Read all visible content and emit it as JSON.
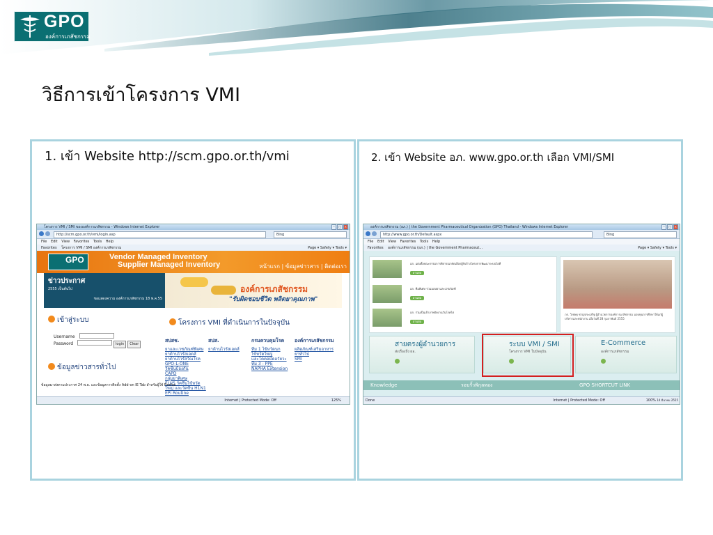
{
  "logo": {
    "name": "GPO",
    "subtitle": "องค์การเภสัชกรรม"
  },
  "slide": {
    "title": "วิธีการเข้าโครงการ VMI"
  },
  "left_panel": {
    "caption": "1. เข้า Website http://scm.gpo.or.th/vmi",
    "browser": {
      "title": "โครงการ VMI / SMI ขององค์การเภสัชกรรม - Windows Internet Explorer",
      "url": "http://scm.gpo.or.th/vmi/login.asp",
      "search": "Bing",
      "menu": "File  Edit  View  Favorites  Tools  Help",
      "favorites": "Favorites",
      "tab": "โครงการ VMI / SMI องค์การเภสัชกรรม",
      "toolbar": "Page ▾  Safety ▾  Tools ▾",
      "status_zone": "Internet | Protected Mode: Off",
      "zoom": "125%"
    },
    "page": {
      "header_line1": "Vendor Managed Inventory",
      "header_line2": "Supplier Managed Inventory",
      "mini_logo": "GPO",
      "header_links": "หน้าแรก | ข้อมูลข่าวสาร | ติดต่อเรา",
      "news_title": "ข่าวประกาศ",
      "news_sub": "2555 เป็นต้นไป",
      "news_sub2": "ขอแสดงความ องค์การเภสัชกรรม 18 พ.ค.55",
      "banner_title": "องค์การเภสัชกรรม",
      "banner_slogan": "\"รับผิดชอบชีวิต พลิตยาคุณภาพ\"",
      "login_title": "เข้าสู่ระบบ",
      "username_label": "Username",
      "password_label": "Password",
      "login_btn": "login",
      "clear_btn": "Clear",
      "projects_title": "โครงการ VMI ที่ดำเนินการในปัจจุบัน",
      "info_title": "ข้อมูลข่าวสารทั่วไป",
      "columns": [
        {
          "head": "สปสช.",
          "items": [
            "ยาและเวชภัณฑ์พิเศษ",
            "ยาต้านไวรัสเอดส์",
            "ยาต้านไวรัสวัณโรค",
            "GPO-L-ONE",
            "วัคซีนป้องกัน",
            "CAPD",
            "กลุ่มยาพิเศษ",
            "FLUS วัคซีนไข้หวัด",
            "ใหญ่ และวัคซีน H1N1",
            "EPI Routine"
          ]
        },
        {
          "head": "สปส.",
          "items": [
            "ยาต้านไวรัสเอดส์"
          ]
        },
        {
          "head": "กรมควบคุมโรค",
          "items": [
            "ทีม 1 ไข้หวัดนก",
            "ไข้หวัดใหญ่",
            "และโคคอมัดอวัยวะ",
            "ทีม 3 - PPE",
            "NAPHA Extension"
          ]
        },
        {
          "head": "องค์การเภสัชกรรม",
          "items": [
            "ผลิตภัณฑ์เสริมอาหาร",
            "ยาทั่วไป",
            "SMI"
          ]
        }
      ],
      "news_line": "ข้อมูลมาส่งตามประกาศ 24 พ.ย. และข้อมูลการติดตั้ง Add-on IE Tab สำหรับผู้ใช้ Firefox"
    }
  },
  "right_panel": {
    "caption": "2. เข้า Website อภ. www.gpo.or.th เลือก VMI/SMI",
    "browser": {
      "title": "องค์การเภสัชกรรม (อภ.) | the Government Pharmaceutical Organization (GPO) Thailand - Windows Internet Explorer",
      "url": "http://www.gpo.or.th/Default.aspx",
      "search": "Bing",
      "menu": "File  Edit  View  Favorites  Tools  Help",
      "favorites": "Favorites",
      "tab": "องค์การเภสัชกรรม (อภ.) | the Government Pharmaceut...",
      "toolbar": "Page ▾  Safety ▾  Tools ▾",
      "status_left": "Done",
      "status_zone": "Internet | Protected Mode: Off",
      "zoom": "100%"
    },
    "page": {
      "news": [
        {
          "text": "อภ. แต่งตั้งคณะกรรมการพิจารณาคัดเลือกผู้รับจ้างโครงการพัฒนาระบบไอที",
          "btn": "อ่านต่อ"
        },
        {
          "text": "อภ. ทีมพิเศษ ร่วมมอบยาและเวชภัณฑ์",
          "btn": "อ่านต่อ"
        },
        {
          "text": "อภ. ร่วมเป็นเจ้าภาพจัดงานวันโรคไต",
          "btn": "อ่านต่อ"
        }
      ],
      "photo_caption": "ภก. วิเชษฐ ชาญประเสริฐ ผู้อำนวยการองค์การเภสัชกรรม มอบทุนการศึกษาให้แก่ผู้บริหารและพนักงาน เมื่อวันที่ 28 กุมภาพันธ์ 2555",
      "tiles": [
        {
          "title": "สายตรงผู้อำนวยการ",
          "sub": "ส่งเรื่องถึง ผอ."
        },
        {
          "title": "ระบบ VMI / SMI",
          "sub": "โครงการ VMI ในปัจจุบัน"
        },
        {
          "title": "E-Commerce",
          "sub": "องค์การเภสัชกรรม"
        }
      ],
      "footer": [
        "Knowledge",
        "รอบรั้วพิกุลทอง",
        "GPO SHORTCUT LINK"
      ],
      "taskbar_date": "14 มีนาคม 2555"
    }
  }
}
